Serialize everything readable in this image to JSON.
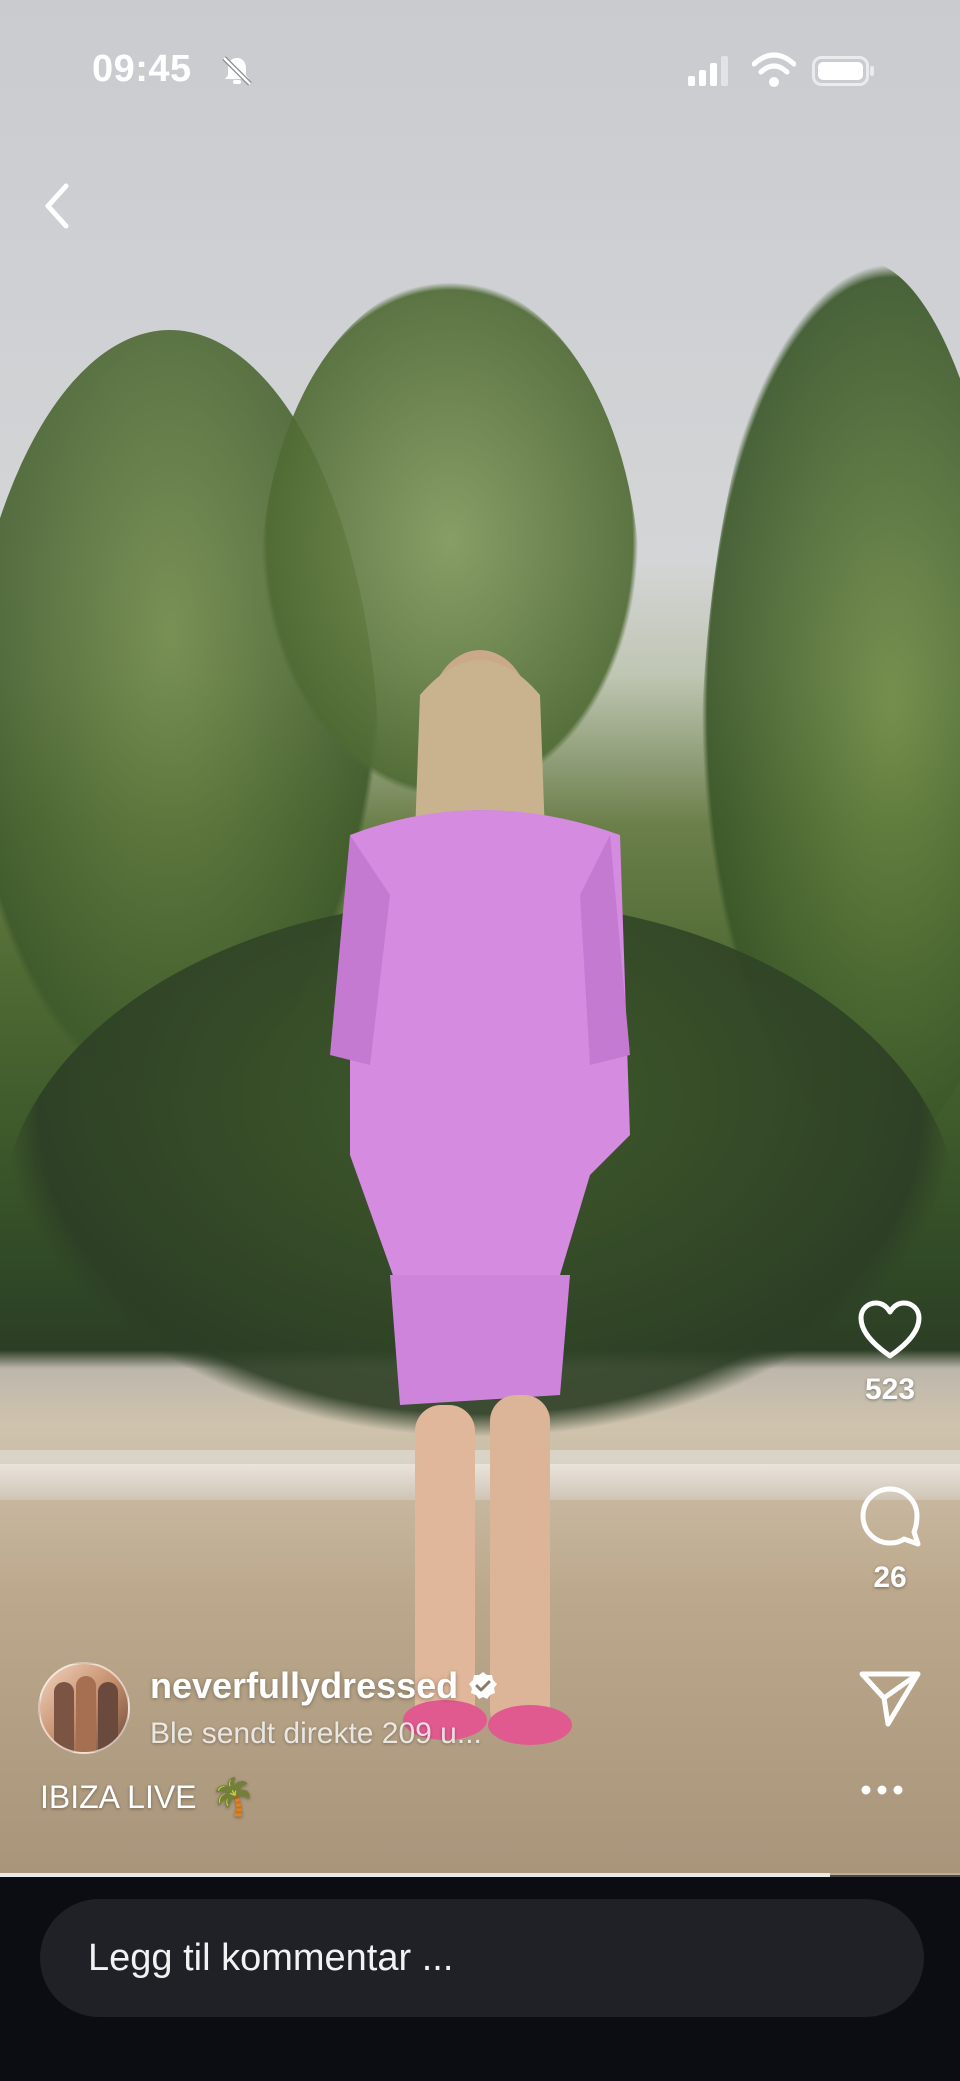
{
  "status_bar": {
    "time": "09:45"
  },
  "side_actions": {
    "likes": "523",
    "comments": "26"
  },
  "profile": {
    "username": "neverfullydressed",
    "subtitle": "Ble sendt direkte 209 u..."
  },
  "caption": {
    "text": "IBIZA LIVE",
    "emoji": "🌴"
  },
  "video": {
    "progress": 0.865
  },
  "comment_bar": {
    "placeholder": "Legg til kommentar ..."
  },
  "colors": {
    "accent_dress": "#d48be0",
    "background": "#0b0d12",
    "input": "#1f2127"
  },
  "icons": [
    "bell-slash-icon",
    "signal-icon",
    "wifi-icon",
    "battery-icon",
    "back-chevron-icon",
    "heart-icon",
    "comment-icon",
    "share-icon",
    "more-icon",
    "verified-icon",
    "palm-tree-icon"
  ]
}
